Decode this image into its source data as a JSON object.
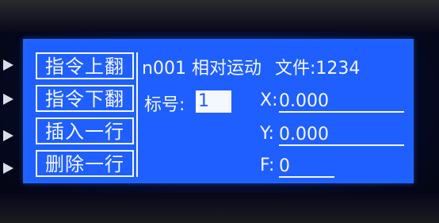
{
  "menu": [
    {
      "label": "指令上翻"
    },
    {
      "label": "指令下翻"
    },
    {
      "label": "插入一行"
    },
    {
      "label": "删除一行"
    }
  ],
  "header": {
    "instruction_no": "n001",
    "instruction_name": "相对运动",
    "file_label": "文件:",
    "file_value": "1234"
  },
  "fields": {
    "tag_label": "标号:",
    "tag_value": "1",
    "x_label": "X:",
    "x_value": "0.000",
    "y_label": "Y:",
    "y_value": "0.000",
    "f_label": "F:",
    "f_value": "0"
  },
  "colors": {
    "screen_bg": "#1f5fff",
    "text": "#f4f7ff"
  }
}
